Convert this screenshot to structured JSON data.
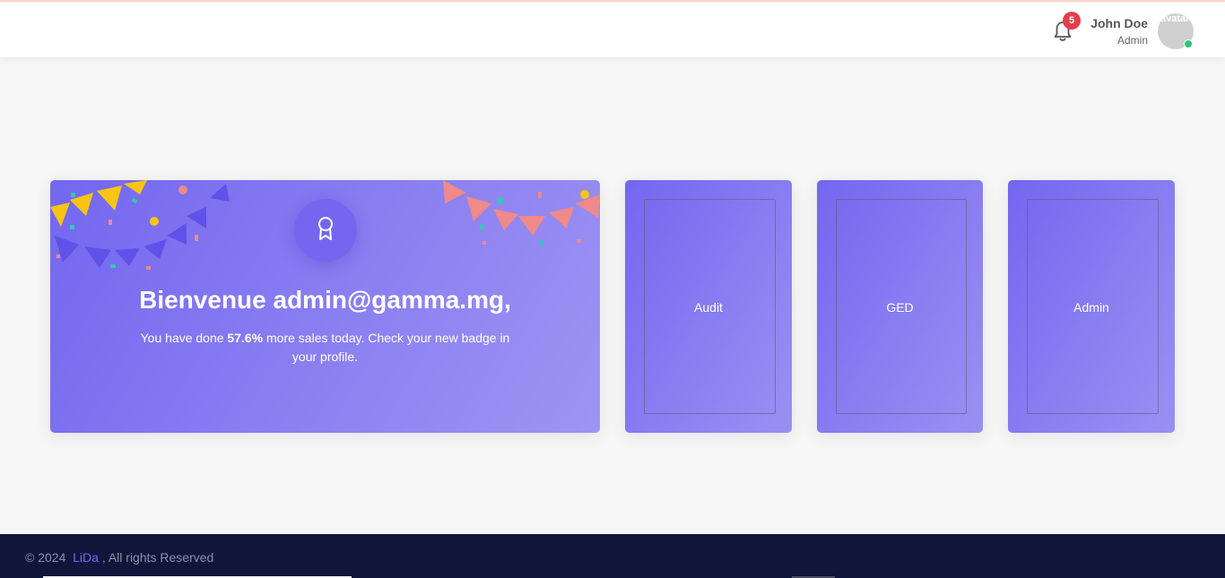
{
  "header": {
    "notifications_count": "5",
    "user_name": "John Doe",
    "user_role": "Admin",
    "avatar_alt": "avatar",
    "status": "online"
  },
  "welcome": {
    "title": "Bienvenue admin@gamma.mg,",
    "text_before": "You have done ",
    "highlight": "57.6%",
    "text_after": " more sales today. Check your new badge in your profile.",
    "icon": "award-icon"
  },
  "tiles": [
    {
      "label": "Audit"
    },
    {
      "label": "GED"
    },
    {
      "label": "Admin"
    }
  ],
  "footer": {
    "prefix": "© 2024",
    "brand": "LiDa",
    "suffix": ", All rights Reserved"
  },
  "colors": {
    "primary": "#7367f0",
    "footer_bg": "#10163a",
    "badge": "#e53e4a",
    "online": "#28c76f"
  }
}
